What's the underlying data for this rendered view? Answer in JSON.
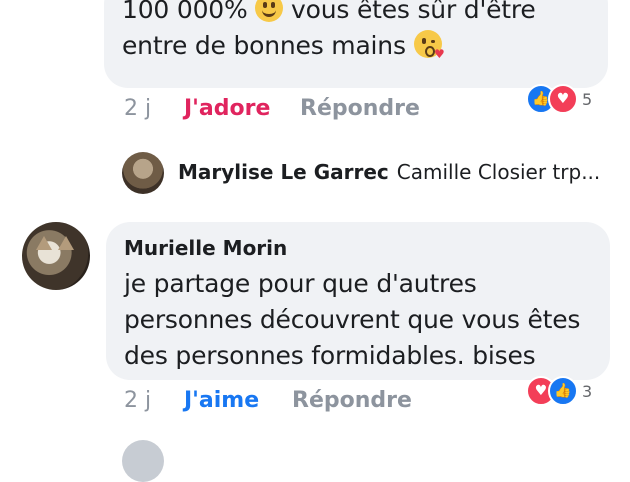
{
  "comment1": {
    "line1": "100 000% ",
    "line1_after": " vous êtes sûr d'être",
    "line2": "entre de bonnes mains ",
    "time": "2 j",
    "like_label": "J'adore",
    "reply_label": "Répondre",
    "reaction_count": "5",
    "reaction_icons": [
      "like-icon",
      "love-icon"
    ],
    "like_color": "#e0245e"
  },
  "reply_preview": {
    "name": "Marylise Le Garrec",
    "text": "Camille Closier trp..."
  },
  "comment2": {
    "author": "Murielle Morin",
    "line1": "je partage pour que d'autres",
    "line2": "personnes découvrent que vous êtes",
    "line3": "des personnes formidables. bises",
    "time": "2 j",
    "like_label": "J'aime",
    "reply_label": "Répondre",
    "reaction_count": "3",
    "reaction_icons": [
      "love-icon",
      "like-icon"
    ],
    "like_color": "#1877f2"
  },
  "colors": {
    "bubble": "#f0f2f5",
    "text": "#1c1e21",
    "muted": "#8d949e",
    "like_blue": "#1877f2",
    "love_red": "#f33e58"
  }
}
